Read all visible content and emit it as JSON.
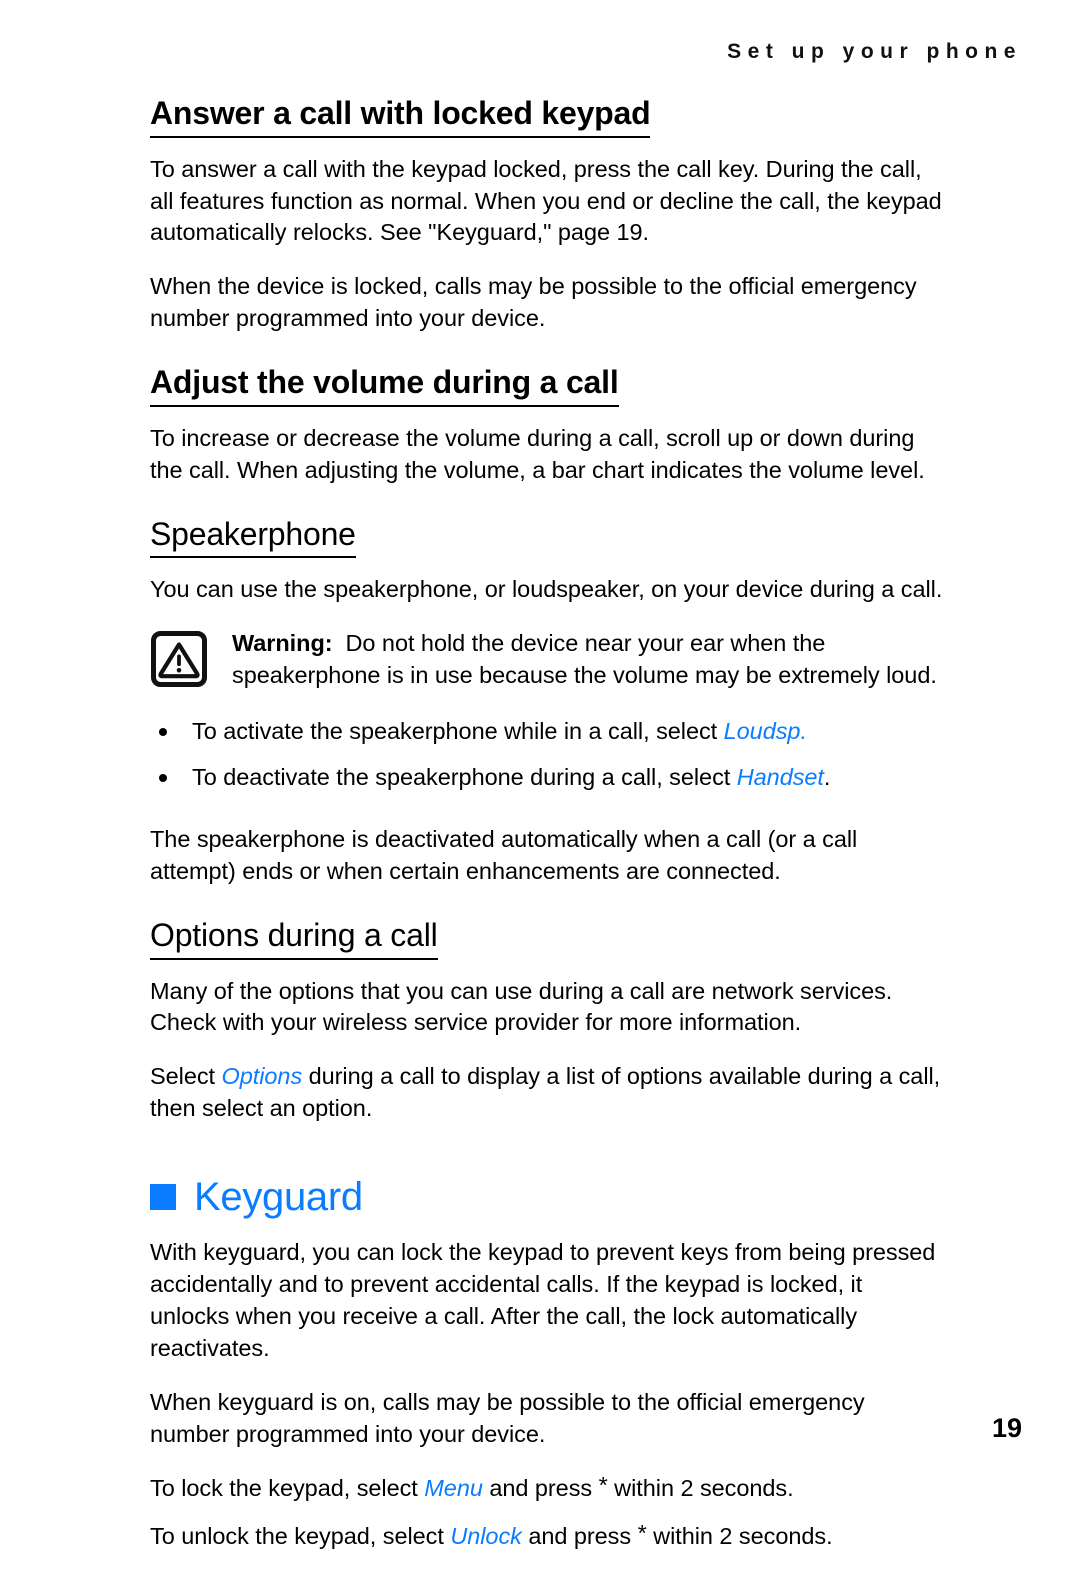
{
  "header": {
    "running_head": "Set up your phone"
  },
  "sections": [
    {
      "heading": "Answer a call with locked keypad",
      "paragraphs": [
        "To answer a call with the keypad locked, press the call key. During the call, all features function as normal. When you end or decline the call, the keypad automatically relocks. See \"Keyguard,\" page 19.",
        "When the device is locked, calls may be possible to the official emergency number programmed into your device."
      ]
    },
    {
      "heading": "Adjust the volume during a call",
      "paragraphs": [
        "To increase or decrease the volume during a call, scroll up or down during the call. When adjusting the volume, a bar chart indicates the volume level."
      ]
    },
    {
      "heading": "Speakerphone",
      "intro": "You can use the speakerphone, or loudspeaker, on your device during a call.",
      "warning": {
        "label": "Warning:",
        "text": "Do not hold the device near your ear when the speakerphone is in use because the volume may be extremely loud."
      },
      "bullets": [
        {
          "lead": "To activate the speakerphone while in a call, select ",
          "emphasis": "Loudsp.",
          "trail": ""
        },
        {
          "lead": "To deactivate the speakerphone during a call, select ",
          "emphasis": "Handset",
          "trail": "."
        }
      ],
      "closing": "The speakerphone is deactivated automatically when a call (or a call attempt) ends or when certain enhancements are connected."
    },
    {
      "heading": "Options during a call",
      "paragraphs": [
        "Many of the options that you can use during a call are network services. Check with your wireless service provider for more information."
      ],
      "select_line": {
        "lead": "Select ",
        "emphasis": "Options",
        "trail": " during a call to display a list of options available during a call, then select an option."
      }
    }
  ],
  "chapter": {
    "title": "Keyguard",
    "paragraphs": [
      "With keyguard, you can lock the keypad to prevent keys from being pressed accidentally and to prevent accidental calls. If the keypad is locked, it unlocks when you receive a call. After the call, the lock automatically reactivates.",
      "When keyguard is on, calls may be possible to the official emergency number programmed into your device."
    ],
    "lock_line": {
      "lead": "To lock the keypad, select ",
      "emphasis": "Menu",
      "mid": " and press ",
      "star": "*",
      "trail": " within 2 seconds."
    },
    "unlock_line": {
      "lead": "To unlock the keypad, select ",
      "emphasis": "Unlock",
      "mid": " and press ",
      "star": "*",
      "trail": " within 2 seconds."
    }
  },
  "footer": {
    "page_number": "19"
  },
  "colors": {
    "accent_blue": "#0a7cff",
    "text_black": "#000000",
    "page_background": "#ffffff"
  },
  "icons": {
    "warning": "warning-triangle-icon",
    "chapter_bullet": "square-bullet-icon"
  }
}
